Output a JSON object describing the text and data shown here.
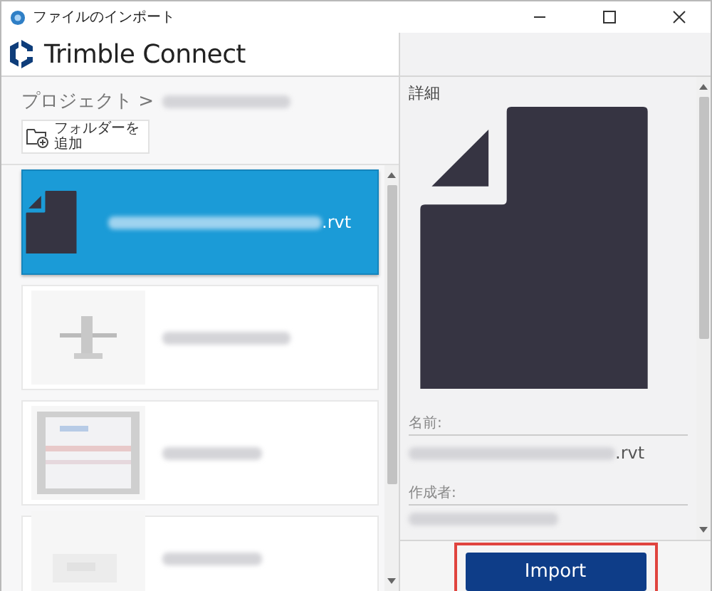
{
  "window": {
    "title": "ファイルのインポート"
  },
  "logo": {
    "text": "Trimble Connect"
  },
  "breadcrumb": {
    "root": "プロジェクト >"
  },
  "add_folder_button": {
    "label": "フォルダーを追加"
  },
  "files": [
    {
      "kind": "document",
      "name_suffix": ".rvt",
      "selected": true
    },
    {
      "kind": "picture",
      "selected": false
    },
    {
      "kind": "picture",
      "selected": false
    },
    {
      "kind": "picture",
      "selected": false
    }
  ],
  "details": {
    "heading": "詳細",
    "fields": [
      {
        "label": "名前:",
        "value_suffix": ".rvt"
      },
      {
        "label": "作成者:"
      }
    ]
  },
  "import_button": {
    "label": "Import",
    "highlighted": true
  }
}
